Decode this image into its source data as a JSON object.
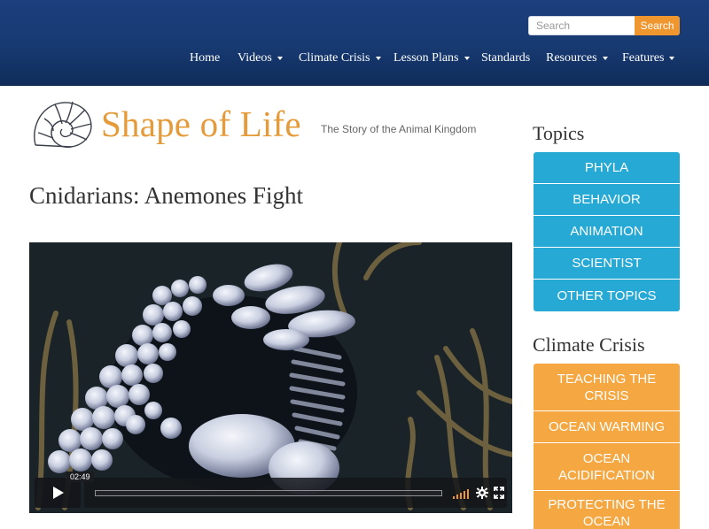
{
  "header": {
    "search": {
      "placeholder": "Search",
      "button_label": "Search"
    },
    "nav": [
      {
        "label": "Home",
        "dropdown": false
      },
      {
        "label": "Videos",
        "dropdown": true
      },
      {
        "label": "Climate Crisis",
        "dropdown": true
      },
      {
        "label": "Lesson Plans",
        "dropdown": true
      },
      {
        "label": "Standards",
        "dropdown": false
      },
      {
        "label": "Resources",
        "dropdown": true
      },
      {
        "label": "Features",
        "dropdown": true
      }
    ]
  },
  "logo": {
    "name": "Shape of Life",
    "tagline": "The Story of the Animal Kingdom",
    "icon": "nautilus-shell-icon"
  },
  "main": {
    "title": "Cnidarians: Anemones Fight",
    "video": {
      "current_time": "02:49",
      "icons": [
        "play-icon",
        "volume-icon",
        "settings-gear-icon",
        "fullscreen-icon"
      ]
    }
  },
  "sidebar": {
    "topics": {
      "heading": "Topics",
      "items": [
        "PHYLA",
        "BEHAVIOR",
        "ANIMATION",
        "SCIENTIST",
        "OTHER TOPICS"
      ]
    },
    "climate": {
      "heading": "Climate Crisis",
      "items": [
        "TEACHING THE CRISIS",
        "OCEAN WARMING",
        "OCEAN ACIDIFICATION",
        "PROTECTING THE OCEAN"
      ]
    }
  },
  "colors": {
    "header_bg": "#173a72",
    "accent_orange": "#f0962f",
    "topic_blue": "#27a9d6",
    "climate_orange": "#f5a742",
    "logo_orange": "#e59b3a"
  }
}
